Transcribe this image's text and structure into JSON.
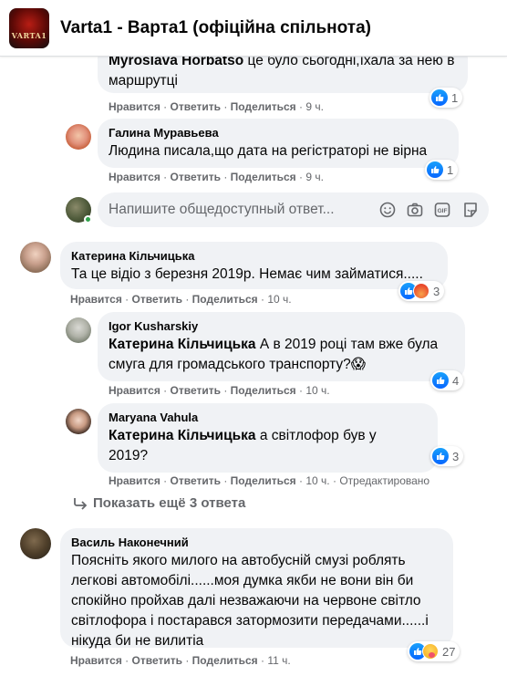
{
  "header": {
    "group_title": "Varta1 - Варта1 (офіційна спільнота)",
    "logo_text": "VARTA1"
  },
  "labels": {
    "like": "Нравится",
    "reply": "Ответить",
    "share": "Поделиться",
    "sep": "·"
  },
  "comments": [
    {
      "author": "Myroslava Horbatso",
      "text": "це було сьогодні,їхала за нею в маршрутці",
      "time": "9 ч.",
      "reactions": "1"
    },
    {
      "author": "Галина Муравьева",
      "text": "Людина писала,що дата на регістраторі не вірна",
      "time": "9 ч.",
      "reactions": "1"
    },
    {
      "author": "Катерина Кільчицька",
      "text": "Та це відіо з березня 2019р. Немає чим займатися.....",
      "time": "10 ч.",
      "reactions": "3"
    },
    {
      "author": "Igor Kusharskiy",
      "mention": "Катерина Кільчицька",
      "text": "А в 2019 році там вже була смуга для громадського транспорту?😱",
      "time": "10 ч.",
      "reactions": "4"
    },
    {
      "author": "Maryana Vahula",
      "mention": "Катерина Кільчицька",
      "text": "а світлофор був у 2019?",
      "time": "10 ч.",
      "edited": "Отредактировано",
      "reactions": "3"
    },
    {
      "author": "Василь Наконечний",
      "text": "Поясніть якого милого на автобусній смузі роблять легкові автомобілі......моя думка якби не вони він би спокійно пройхав далі незважаючи на червоне світло світлофора і постарався затормозити передачами......і нікуда би не вилитіа",
      "time": "11 ч.",
      "reactions": "27"
    }
  ],
  "reply_box": {
    "placeholder": "Напишите общедоступный ответ..."
  },
  "more_replies": {
    "label": "Показать ещё 3 ответа"
  },
  "colors": {
    "like_blue": "#0866ff",
    "bubble_bg": "#f0f2f5",
    "secondary_text": "#65676b"
  }
}
